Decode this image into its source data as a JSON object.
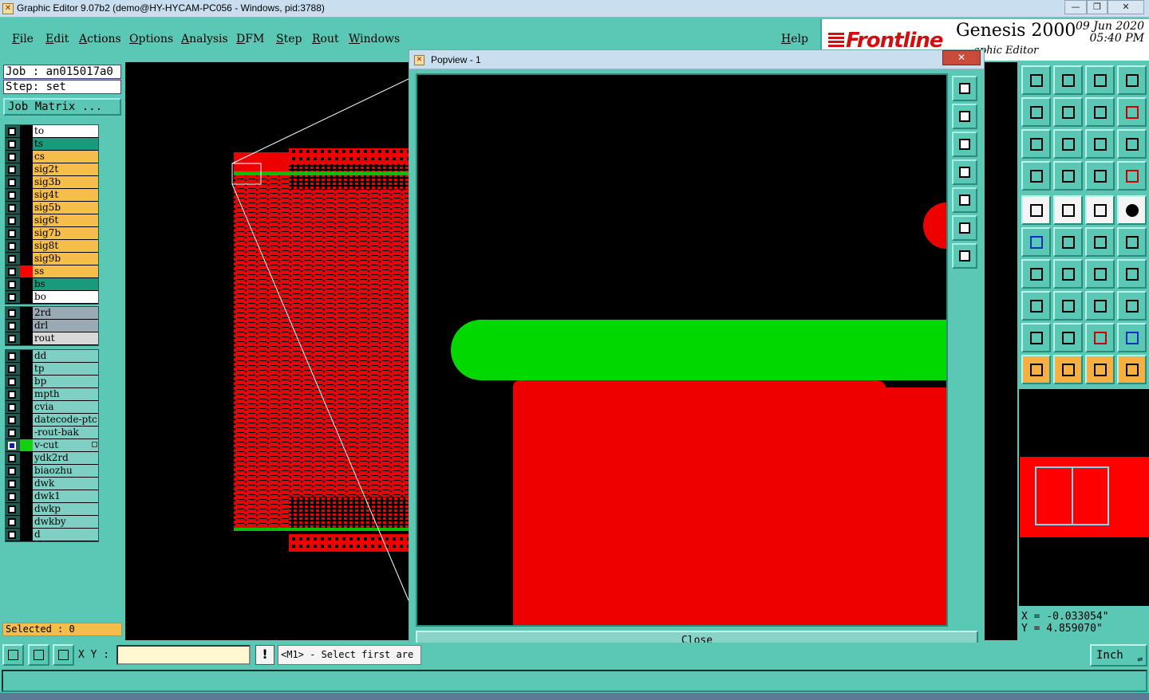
{
  "window": {
    "title": "Graphic Editor 9.07b2 (demo@HY-HYCAM-PC056 - Windows, pid:3788)"
  },
  "menu": [
    "File",
    "Edit",
    "Actions",
    "Options",
    "Analysis",
    "DFM",
    "Step",
    "Rout",
    "Windows"
  ],
  "help_label": "Help",
  "brand": {
    "logo": "Frontline",
    "product": "Genesis 2000",
    "subtitle": "aphic Editor",
    "date": "09  Jun  2020",
    "time": "05:40  PM"
  },
  "job": {
    "job_label": "Job : an015017a0",
    "step_label": "Step: set",
    "matrix_button": "Job Matrix ..."
  },
  "layers_board": [
    {
      "name": "to",
      "color": "#ffffff",
      "swatch": "#000000"
    },
    {
      "name": "ts",
      "color": "#1a9a7c",
      "swatch": "#000000"
    },
    {
      "name": "cs",
      "color": "#f5bd4a",
      "swatch": "#000000"
    },
    {
      "name": "sig2t",
      "color": "#f5bd4a",
      "swatch": "#000000"
    },
    {
      "name": "sig3b",
      "color": "#f5bd4a",
      "swatch": "#000000"
    },
    {
      "name": "sig4t",
      "color": "#f5bd4a",
      "swatch": "#000000"
    },
    {
      "name": "sig5b",
      "color": "#f5bd4a",
      "swatch": "#000000"
    },
    {
      "name": "sig6t",
      "color": "#f5bd4a",
      "swatch": "#000000"
    },
    {
      "name": "sig7b",
      "color": "#f5bd4a",
      "swatch": "#000000"
    },
    {
      "name": "sig8t",
      "color": "#f5bd4a",
      "swatch": "#000000"
    },
    {
      "name": "sig9b",
      "color": "#f5bd4a",
      "swatch": "#000000"
    },
    {
      "name": "ss",
      "color": "#f5bd4a",
      "swatch": "#ff0000"
    },
    {
      "name": "bs",
      "color": "#1a9a7c",
      "swatch": "#000000"
    },
    {
      "name": "bo",
      "color": "#ffffff",
      "swatch": "#000000"
    }
  ],
  "layers_drill": [
    {
      "name": "2rd",
      "color": "#9aaab5",
      "swatch": "#000000"
    },
    {
      "name": "drl",
      "color": "#9aaab5",
      "swatch": "#000000"
    },
    {
      "name": "rout",
      "color": "#d8d8d8",
      "swatch": "#000000"
    }
  ],
  "layers_misc": [
    {
      "name": "dd",
      "color": "#7fd0c4",
      "swatch": "#000000"
    },
    {
      "name": "tp",
      "color": "#7fd0c4",
      "swatch": "#000000"
    },
    {
      "name": "bp",
      "color": "#7fd0c4",
      "swatch": "#000000"
    },
    {
      "name": "mpth",
      "color": "#7fd0c4",
      "swatch": "#000000"
    },
    {
      "name": "cvia",
      "color": "#7fd0c4",
      "swatch": "#000000"
    },
    {
      "name": "datecode-ptc",
      "color": "#7fd0c4",
      "swatch": "#000000"
    },
    {
      "name": "-rout-bak",
      "color": "#7fd0c4",
      "swatch": "#000000"
    },
    {
      "name": "v-cut",
      "color": "#7fd0c4",
      "swatch": "#10d010",
      "checked": true
    },
    {
      "name": "ydk2rd",
      "color": "#7fd0c4",
      "swatch": "#000000"
    },
    {
      "name": "biaozhu",
      "color": "#7fd0c4",
      "swatch": "#000000"
    },
    {
      "name": "dwk",
      "color": "#7fd0c4",
      "swatch": "#000000"
    },
    {
      "name": "dwk1",
      "color": "#7fd0c4",
      "swatch": "#000000"
    },
    {
      "name": "dwkp",
      "color": "#7fd0c4",
      "swatch": "#000000"
    },
    {
      "name": "dwkby",
      "color": "#7fd0c4",
      "swatch": "#000000"
    },
    {
      "name": "d",
      "color": "#7fd0c4",
      "swatch": "#000000"
    }
  ],
  "selected_label": "Selected : 0",
  "popview": {
    "title": "Popview - 1",
    "close_x": "✕",
    "close_button": "Close"
  },
  "coords": {
    "x": "X = -0.033054\"",
    "y": "Y = 4.859070\""
  },
  "bottom": {
    "xy_label": "X Y :",
    "xy_value": "",
    "status_icon": "!",
    "prompt": "<M1> - Select first are",
    "units": "Inch"
  },
  "colors": {
    "panel": "#5bc8b5",
    "board": "#ff0000",
    "vcut": "#00d000"
  },
  "icons": {
    "popview_tools": [
      "zoom-window-icon",
      "pan-up-icon",
      "pan-down-icon",
      "pan-left-icon",
      "pan-right-icon",
      "zoom-home-icon",
      "zoom-fit-icon"
    ],
    "right_tools": [
      "pan-up-icon",
      "pan-down-icon",
      "zoom-home-icon",
      "split-view-icon",
      "pan-left-icon",
      "pan-right-icon",
      "zoom-back-icon",
      "redraw-icon",
      "zoom-in-icon",
      "zoom-out-icon",
      "scale-1-2-icon",
      "help-icon",
      "snap-tools-icon",
      "grid-icon",
      "layer-colors-icon",
      "layer-colors-red-icon",
      "pad-icon",
      "line-color-icon",
      "ruler-icon",
      "dot-icon",
      "connect-icon",
      "delete-node-icon",
      "move-node-icon",
      "arc-node-icon",
      "angle-measure-icon",
      "line-edit-icon",
      "rotate-icon",
      "mirror-icon",
      "pad-select-icon",
      "line-cut-icon",
      "resize-icon",
      "shapes-icon",
      "triangle-icon",
      "text-a-icon",
      "text-a-red-icon",
      "text-a-blue-icon",
      "pointer-icon",
      "pointer-box-icon",
      "pointer-circle-icon",
      "pointer-route-icon"
    ]
  }
}
